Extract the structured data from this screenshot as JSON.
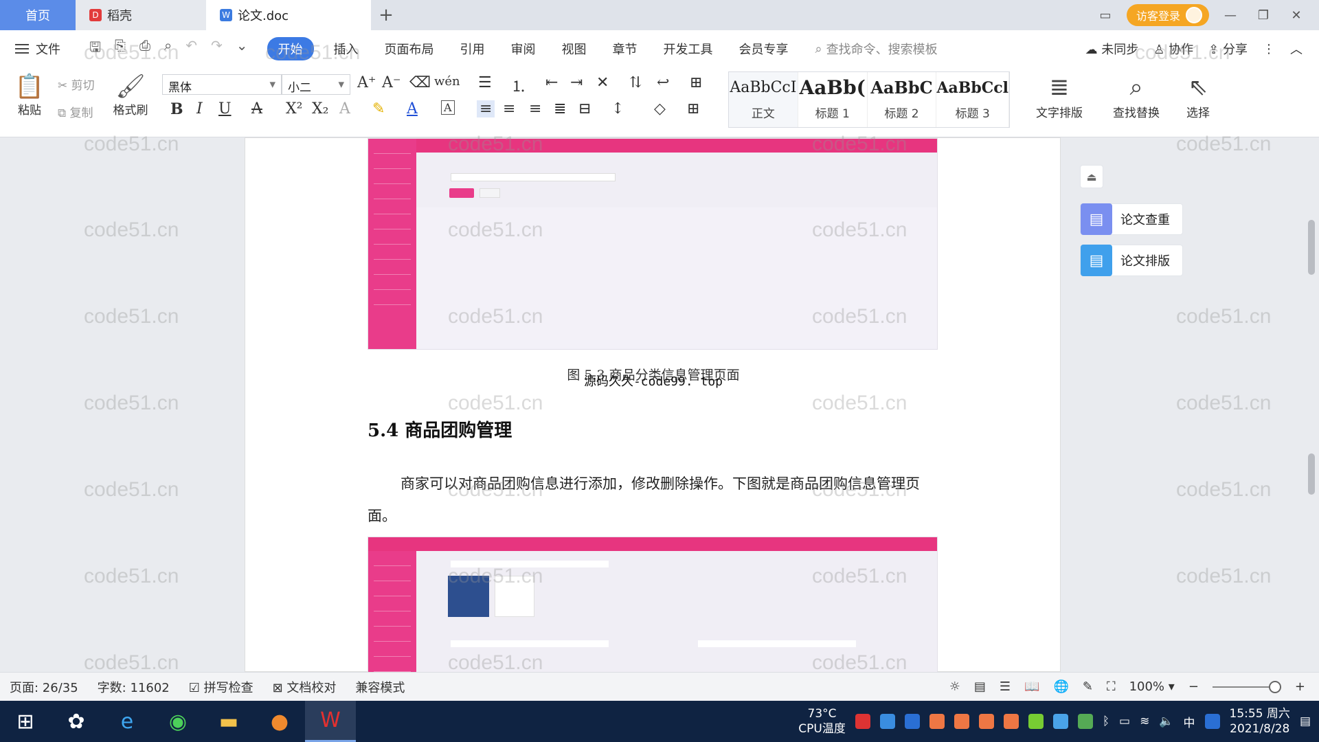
{
  "tabs": [
    {
      "label": "首页"
    },
    {
      "label": "稻壳"
    },
    {
      "label": "论文.doc"
    }
  ],
  "titlebar": {
    "login": "访客登录"
  },
  "menu": {
    "file": "文件",
    "items": [
      "开始",
      "插入",
      "页面布局",
      "引用",
      "审阅",
      "视图",
      "章节",
      "开发工具",
      "会员专享"
    ],
    "search_placeholder": "查找命令、搜索模板",
    "unsynced": "未同步",
    "collab": "协作",
    "share": "分享"
  },
  "toolbar": {
    "paste": "粘贴",
    "cut": "剪切",
    "copy": "复制",
    "format_painter": "格式刷",
    "font": "黑体",
    "size": "小二",
    "styles": [
      {
        "preview": "AaBbCcI",
        "name": "正文"
      },
      {
        "preview": "AaBb(",
        "name": "标题 1"
      },
      {
        "preview": "AaBbC",
        "name": "标题 2"
      },
      {
        "preview": "AaBbCcl",
        "name": "标题 3"
      }
    ],
    "text_layout": "文字排版",
    "find_replace": "查找替换",
    "select": "选择"
  },
  "doc": {
    "figure1_caption": "图 5.3  商品分类信息管理页面",
    "overlay_text": "源码久久-code99. top",
    "heading": "5.4  商品团购管理",
    "paragraph": "商家可以对商品团购信息进行添加，修改删除操作。下图就是商品团购信息管理页面。"
  },
  "sidepanel": {
    "check": "论文查重",
    "layout": "论文排版"
  },
  "status": {
    "page": "页面: 26/35",
    "words": "字数: 11602",
    "spell": "拼写检查",
    "proof": "文档校对",
    "compat": "兼容模式",
    "zoom": "100%"
  },
  "taskbar": {
    "temp": "73°C",
    "cpu": "CPU温度",
    "ime": "中",
    "time": "15:55 周六",
    "date": "2021/8/28"
  },
  "watermark": "code51.cn",
  "colors": {
    "accent": "#3c7ae4",
    "pink": "#e93c8a",
    "login": "#f5a623"
  }
}
